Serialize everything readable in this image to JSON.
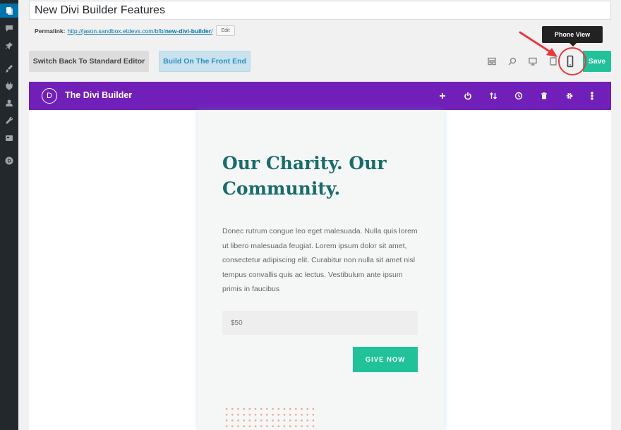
{
  "editor": {
    "post_title": "New Divi Builder Features",
    "permalink_label": "Permalink:",
    "permalink_base": "http://jason.sandbox.etdevs.com/bfb/",
    "permalink_slug": "new-divi-builder",
    "permalink_tail": "/",
    "edit_label": "Edit",
    "switch_label": "Switch Back To Standard Editor",
    "frontend_label": "Build On The Front End",
    "save_label": "Save",
    "tooltip": "Phone View"
  },
  "view_icons": [
    "wireframe-icon",
    "zoom-icon",
    "desktop-icon",
    "tablet-icon",
    "phone-icon"
  ],
  "divi_bar": {
    "logo_letter": "D",
    "title": "The Divi Builder",
    "icons": [
      "plus-icon",
      "power-icon",
      "sort-icon",
      "history-icon",
      "trash-icon",
      "gear-icon",
      "more-icon"
    ]
  },
  "content": {
    "headline": "Our Charity. Our Community.",
    "body": "Donec rutrum congue leo eget malesuada. Nulla quis lorem ut libero malesuada feugiat. Lorem ipsum dolor sit amet, consectetur adipiscing elit. Curabitur non nulla sit amet nisl tempus convallis quis ac lectus.  Vestibulum ante ipsum primis in faucibus",
    "amount_value": "$50",
    "give_label": "GIVE NOW"
  },
  "colors": {
    "divi_purple": "#7020b8",
    "accent_green": "#21c29a",
    "headline_teal": "#1a6b6b",
    "wp_admin": "#23282d",
    "annotation_red": "#e8383d"
  }
}
